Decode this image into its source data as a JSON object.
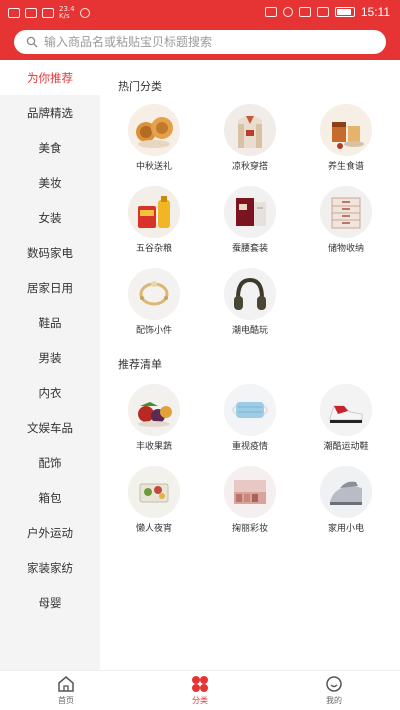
{
  "status_bar": {
    "network_text": "23.4\nK/s",
    "time": "15:11"
  },
  "search": {
    "placeholder": "输入商品名或粘贴宝贝标题搜索"
  },
  "sidebar": {
    "items": [
      {
        "label": "为你推荐",
        "active": true
      },
      {
        "label": "品牌精选"
      },
      {
        "label": "美食"
      },
      {
        "label": "美妆"
      },
      {
        "label": "女装"
      },
      {
        "label": "数码家电"
      },
      {
        "label": "居家日用"
      },
      {
        "label": "鞋品"
      },
      {
        "label": "男装"
      },
      {
        "label": "内衣"
      },
      {
        "label": "文娱车品"
      },
      {
        "label": "配饰"
      },
      {
        "label": "箱包"
      },
      {
        "label": "户外运动"
      },
      {
        "label": "家装家纺"
      },
      {
        "label": "母婴"
      }
    ]
  },
  "sections": {
    "hot": {
      "title": "热门分类",
      "items": [
        {
          "label": "中秋送礼",
          "icon": "mooncake-icon"
        },
        {
          "label": "凉秋穿搭",
          "icon": "clothes-icon"
        },
        {
          "label": "养生食谱",
          "icon": "tea-icon"
        },
        {
          "label": "五谷杂粮",
          "icon": "grain-icon"
        },
        {
          "label": "蚕腰套装",
          "icon": "box-set-icon"
        },
        {
          "label": "储物收纳",
          "icon": "drawer-icon"
        },
        {
          "label": "配饰小件",
          "icon": "bracelet-icon"
        },
        {
          "label": "潮电酷玩",
          "icon": "headphones-icon"
        }
      ]
    },
    "recommend": {
      "title": "推荐清单",
      "items": [
        {
          "label": "丰收果蔬",
          "icon": "fruit-icon"
        },
        {
          "label": "重视疫情",
          "icon": "mask-icon"
        },
        {
          "label": "潮酷运动鞋",
          "icon": "sneaker-icon"
        },
        {
          "label": "懒人夜宵",
          "icon": "snack-icon"
        },
        {
          "label": "掬丽彩妆",
          "icon": "palette-icon"
        },
        {
          "label": "家用小电",
          "icon": "iron-icon"
        }
      ]
    }
  },
  "bottom_nav": {
    "items": [
      {
        "label": "首页",
        "icon": "home-icon"
      },
      {
        "label": "分类",
        "icon": "category-icon",
        "active": true
      },
      {
        "label": "我的",
        "icon": "profile-icon"
      }
    ]
  },
  "colors": {
    "brand": "#e63434",
    "sidebar_bg": "#f4f4f4"
  }
}
